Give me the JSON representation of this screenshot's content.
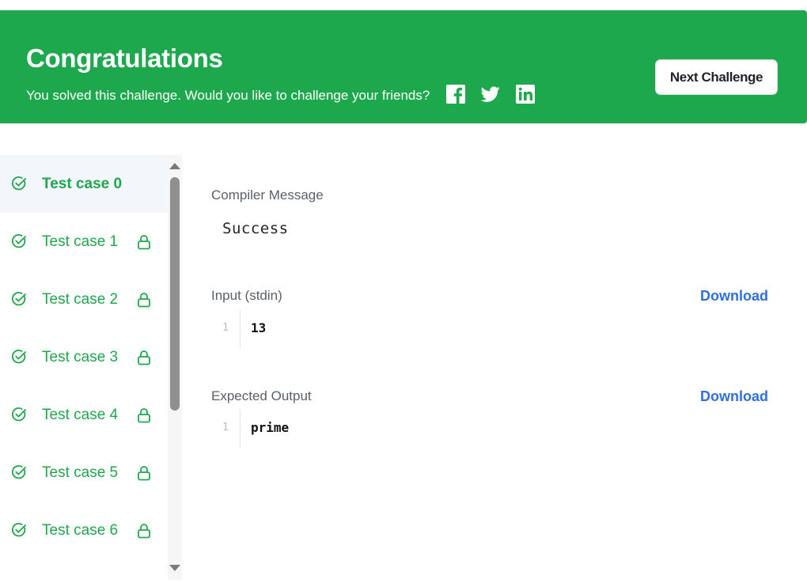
{
  "banner": {
    "title": "Congratulations",
    "subtitle": "You solved this challenge. Would you like to challenge your friends?",
    "share_icons": [
      "facebook-icon",
      "twitter-icon",
      "linkedin-icon"
    ],
    "next_button_label": "Next Challenge",
    "color": "#1ea84d"
  },
  "test_cases": [
    {
      "label": "Test case 0",
      "passed": true,
      "locked": false,
      "active": true
    },
    {
      "label": "Test case 1",
      "passed": true,
      "locked": true,
      "active": false
    },
    {
      "label": "Test case 2",
      "passed": true,
      "locked": true,
      "active": false
    },
    {
      "label": "Test case 3",
      "passed": true,
      "locked": true,
      "active": false
    },
    {
      "label": "Test case 4",
      "passed": true,
      "locked": true,
      "active": false
    },
    {
      "label": "Test case 5",
      "passed": true,
      "locked": true,
      "active": false
    },
    {
      "label": "Test case 6",
      "passed": true,
      "locked": true,
      "active": false
    }
  ],
  "compiler": {
    "label": "Compiler Message",
    "message": "Success"
  },
  "input": {
    "label": "Input (stdin)",
    "download_label": "Download",
    "line_number": "1",
    "value": "13"
  },
  "expected_output": {
    "label": "Expected Output",
    "download_label": "Download",
    "line_number": "1",
    "value": "prime"
  },
  "colors": {
    "accent_green": "#1ea84d",
    "link_blue": "#2f6fe0"
  }
}
